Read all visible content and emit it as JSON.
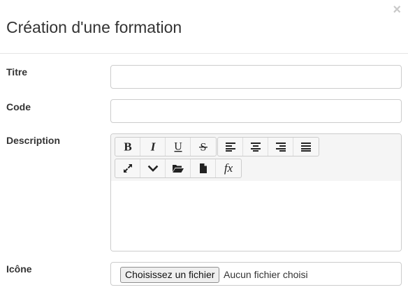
{
  "dialog": {
    "title": "Création d'une formation",
    "close_label": "×"
  },
  "fields": {
    "titre": {
      "label": "Titre",
      "value": "",
      "placeholder": ""
    },
    "code": {
      "label": "Code",
      "value": "",
      "placeholder": ""
    },
    "description": {
      "label": "Description",
      "value": ""
    },
    "icone": {
      "label": "Icône",
      "button_label": "Choisissez un fichier",
      "status": "Aucun fichier choisi"
    }
  },
  "toolbar": {
    "row1_group1": [
      "bold",
      "italic",
      "underline",
      "strikethrough"
    ],
    "row1_group2": [
      "align-left",
      "align-center",
      "align-right",
      "align-justify"
    ],
    "row2_group1": [
      "fullscreen",
      "more",
      "open-folder",
      "file",
      "formula"
    ],
    "formula_glyph": "fx"
  }
}
